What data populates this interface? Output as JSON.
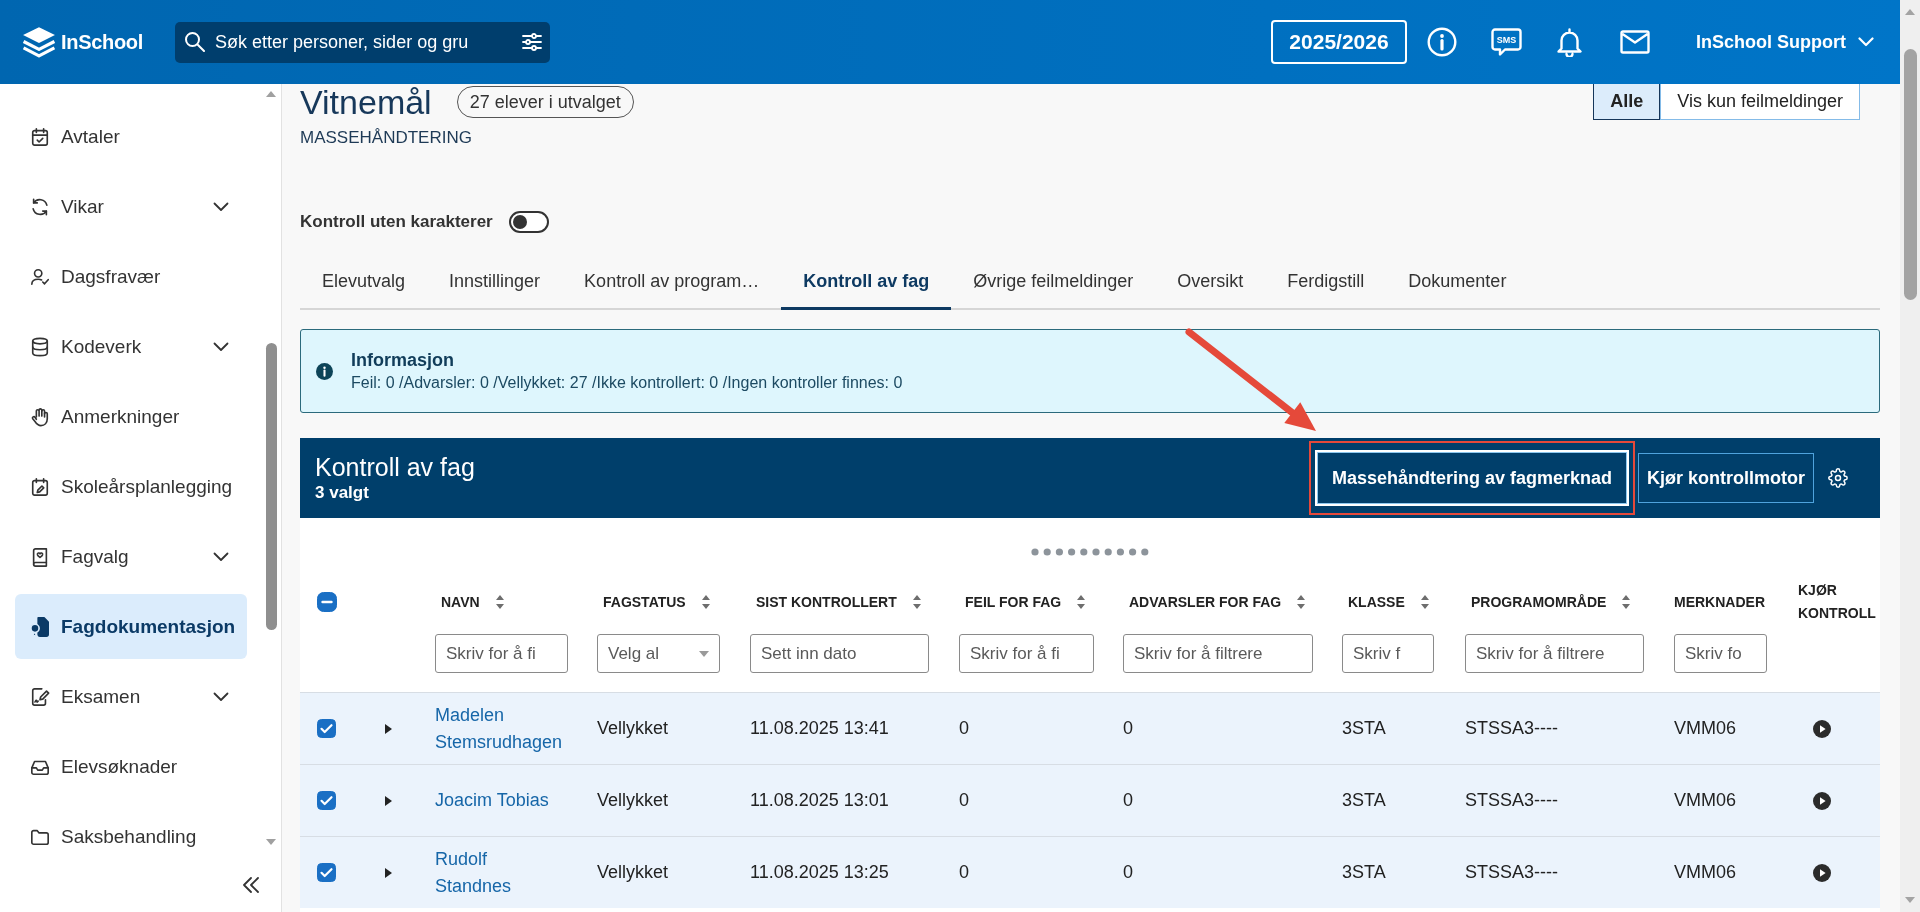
{
  "top_bar": {
    "logo_text": "InSchool",
    "search": {
      "placeholder": "Søk etter personer, sider og gru"
    },
    "school_year": "2025/2026",
    "sms_label": "SMS",
    "user": "InSchool Support"
  },
  "sidebar": {
    "items": [
      {
        "label": "Avtaler",
        "expandable": false,
        "selected": false
      },
      {
        "label": "Vikar",
        "expandable": true,
        "selected": false
      },
      {
        "label": "Dagsfravær",
        "expandable": false,
        "selected": false
      },
      {
        "label": "Kodeverk",
        "expandable": true,
        "selected": false
      },
      {
        "label": "Anmerkninger",
        "expandable": false,
        "selected": false
      },
      {
        "label": "Skoleårsplanlegging",
        "expandable": false,
        "selected": false
      },
      {
        "label": "Fagvalg",
        "expandable": true,
        "selected": false
      },
      {
        "label": "Fagdokumentasjon",
        "expandable": false,
        "selected": true
      },
      {
        "label": "Eksamen",
        "expandable": true,
        "selected": false
      },
      {
        "label": "Elevsøknader",
        "expandable": false,
        "selected": false
      },
      {
        "label": "Saksbehandling",
        "expandable": false,
        "selected": false
      }
    ]
  },
  "page": {
    "title": "Vitnemål",
    "count_badge": "27 elever i utvalget",
    "subtitle": "MASSEHÅNDTERING",
    "view_filter": [
      {
        "label": "Alle",
        "selected": true
      },
      {
        "label": "Vis kun feilmeldinger",
        "selected": false
      }
    ],
    "toggle": {
      "label": "Kontroll uten karakterer",
      "on": false
    }
  },
  "tabs": [
    {
      "label": "Elevutvalg",
      "selected": false
    },
    {
      "label": "Innstillinger",
      "selected": false
    },
    {
      "label": "Kontroll av program…",
      "selected": false
    },
    {
      "label": "Kontroll av fag",
      "selected": true
    },
    {
      "label": "Øvrige feilmeldinger",
      "selected": false
    },
    {
      "label": "Oversikt",
      "selected": false
    },
    {
      "label": "Ferdigstill",
      "selected": false
    },
    {
      "label": "Dokumenter",
      "selected": false
    }
  ],
  "info": {
    "title": "Informasjon",
    "text": "Feil: 0 /Advarsler: 0 /Vellykket: 27 /Ikke kontrollert: 0 /Ingen kontroller finnes: 0"
  },
  "table_panel": {
    "title": "Kontroll av fag",
    "selected_count": "3 valgt",
    "buttons": [
      {
        "label": "Massehåndtering av fagmerknad",
        "focused": true,
        "highlighted": true
      },
      {
        "label": "Kjør kontrollmotor",
        "focused": false,
        "highlighted": false
      }
    ]
  },
  "table": {
    "select_all": {
      "indeterminate": true
    },
    "columns": [
      {
        "label": "NAVN",
        "kind": "link",
        "sortable": true,
        "filter": {
          "kind": "text",
          "placeholder": "Skriv for å fi"
        }
      },
      {
        "label": "FAGSTATUS",
        "kind": "text",
        "sortable": true,
        "filter": {
          "kind": "select",
          "placeholder": "Velg al"
        }
      },
      {
        "label": "SIST KONTROLLERT",
        "kind": "text",
        "sortable": true,
        "filter": {
          "kind": "text",
          "placeholder": "Sett inn dato"
        }
      },
      {
        "label": "FEIL FOR FAG",
        "kind": "text",
        "sortable": true,
        "filter": {
          "kind": "text",
          "placeholder": "Skriv for å fi"
        }
      },
      {
        "label": "ADVARSLER FOR FAG",
        "kind": "text",
        "sortable": true,
        "filter": {
          "kind": "text",
          "placeholder": "Skriv for å filtrere"
        }
      },
      {
        "label": "KLASSE",
        "kind": "text",
        "sortable": true,
        "filter": {
          "kind": "text",
          "placeholder": "Skriv f"
        }
      },
      {
        "label": "PROGRAMOMRÅDE",
        "kind": "text",
        "sortable": true,
        "filter": {
          "kind": "text",
          "placeholder": "Skriv for å filtrere"
        }
      },
      {
        "label": "MERKNADER",
        "kind": "text",
        "sortable": false,
        "filter": {
          "kind": "text",
          "placeholder": "Skriv fo"
        }
      },
      {
        "label": "KJØR KONTROLL",
        "kind": "action",
        "sortable": false
      }
    ],
    "rows": [
      {
        "checked": true,
        "expanded": false,
        "cells": [
          "Madelen Stemsrudhagen",
          "Vellykket",
          "11.08.2025 13:41",
          "0",
          "0",
          "3STA",
          "STSSA3----",
          "VMM06"
        ]
      },
      {
        "checked": true,
        "expanded": false,
        "cells": [
          "Joacim Tobias",
          "Vellykket",
          "11.08.2025 13:01",
          "0",
          "0",
          "3STA",
          "STSSA3----",
          "VMM06"
        ]
      },
      {
        "checked": true,
        "expanded": false,
        "cells": [
          "Rudolf Standnes",
          "Vellykket",
          "11.08.2025 13:25",
          "0",
          "0",
          "3STA",
          "STSSA3----",
          "VMM06"
        ]
      }
    ]
  }
}
